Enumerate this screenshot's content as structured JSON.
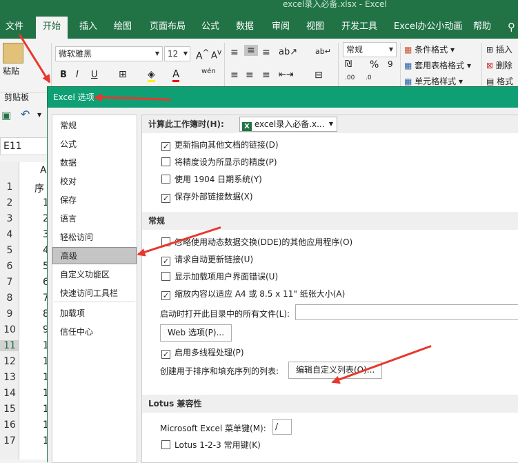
{
  "window": {
    "title": "excel录入必备.xlsx  -  Excel"
  },
  "tabs": [
    "文件",
    "开始",
    "插入",
    "绘图",
    "页面布局",
    "公式",
    "数据",
    "审阅",
    "视图",
    "开发工具",
    "Excel办公小动画",
    "帮助"
  ],
  "ribbon": {
    "paste_label": "粘贴",
    "clipboard_label": "剪贴板",
    "font_name": "微软雅黑",
    "font_size": "12",
    "bold": "B",
    "italic": "I",
    "underline": "U",
    "number_format": "常规",
    "percent": "%",
    "conditional_format": "条件格式",
    "table_format": "套用表格格式",
    "cell_style": "单元格样式",
    "insert": "插入",
    "delete": "删除",
    "format": "格式"
  },
  "sheet": {
    "name_box": "E11",
    "column_a": "A",
    "a1_partial": "序",
    "rows": [
      "1",
      "2",
      "3",
      "4",
      "5",
      "6",
      "7",
      "8",
      "9",
      "10",
      "11",
      "12",
      "13",
      "14",
      "15",
      "16",
      "17"
    ],
    "selected_row": "11",
    "col_values": [
      "1",
      "2",
      "3",
      "4",
      "5",
      "6",
      "7",
      "8",
      "9",
      "1",
      "1",
      "1",
      "1",
      "1",
      "1",
      "1"
    ]
  },
  "dialog": {
    "title": "Excel 选项",
    "nav": [
      "常规",
      "公式",
      "数据",
      "校对",
      "保存",
      "语言",
      "轻松访问",
      "高级",
      "自定义功能区",
      "快速访问工具栏",
      "加载项",
      "信任中心"
    ],
    "active_nav": "高级",
    "workbook_label": "计算此工作簿时(H):",
    "workbook_value": "excel录入必备.x...",
    "workbook_options": [
      {
        "label": "更新指向其他文档的链接(D)",
        "checked": true
      },
      {
        "label": "将精度设为所显示的精度(P)",
        "checked": false
      },
      {
        "label": "使用 1904 日期系统(Y)",
        "checked": false
      },
      {
        "label": "保存外部链接数据(X)",
        "checked": true
      }
    ],
    "general_header": "常规",
    "general_options": [
      {
        "label": "忽略使用动态数据交换(DDE)的其他应用程序(O)",
        "checked": false
      },
      {
        "label": "请求自动更新链接(U)",
        "checked": true
      },
      {
        "label": "显示加载项用户界面错误(U)",
        "checked": false
      },
      {
        "label": "缩放内容以适应 A4 或 8.5 x 11\" 纸张大小(A)",
        "checked": true
      }
    ],
    "startup_label": "启动时打开此目录中的所有文件(L):",
    "web_options_button": "Web 选项(P)...",
    "multithread": {
      "label": "启用多线程处理(P)",
      "checked": true
    },
    "custom_list_label": "创建用于排序和填充序列的列表:",
    "custom_list_button": "编辑自定义列表(O)...",
    "lotus_header": "Lotus 兼容性",
    "ms_menu_key_label": "Microsoft Excel 菜单键(M):",
    "ms_menu_key_value": "/",
    "lotus_keys": {
      "label": "Lotus 1-2-3 常用键(K)",
      "checked": false
    }
  },
  "colors": {
    "excel_green": "#217346",
    "dialog_title": "#0e9f74",
    "arrow_red": "#e8372c"
  }
}
